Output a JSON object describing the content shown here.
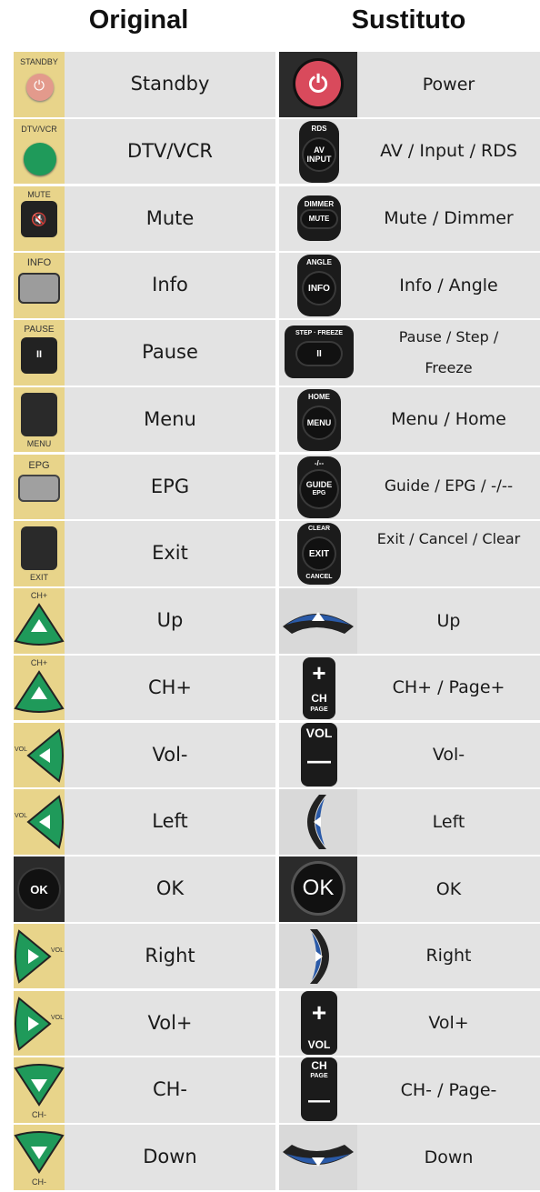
{
  "headers": {
    "original": "Original",
    "substitute": "Sustituto"
  },
  "rows": [
    {
      "original": "Standby",
      "substitute": "Power",
      "orig_icon": {
        "caption": "STANDBY",
        "symbol": "⏻"
      },
      "sub_icon": {
        "symbol": "⏻"
      }
    },
    {
      "original": "DTV/VCR",
      "substitute": "AV / Input / RDS",
      "orig_icon": {
        "caption": "DTV/VCR"
      },
      "sub_icon": {
        "top": "RDS",
        "line1": "AV",
        "line2": "INPUT"
      }
    },
    {
      "original": "Mute",
      "substitute": "Mute / Dimmer",
      "orig_icon": {
        "caption": "MUTE",
        "symbol": "🔇"
      },
      "sub_icon": {
        "top": "DIMMER",
        "line1": "MUTE"
      }
    },
    {
      "original": "Info",
      "substitute": "Info / Angle",
      "orig_icon": {
        "caption": "INFO"
      },
      "sub_icon": {
        "top": "ANGLE",
        "line1": "INFO"
      }
    },
    {
      "original": "Pause",
      "substitute": "Pause / Step / Freeze",
      "orig_icon": {
        "caption": "PAUSE",
        "symbol": "II"
      },
      "sub_icon": {
        "top": "STEP · FREEZE",
        "line1": "II"
      }
    },
    {
      "original": "Menu",
      "substitute": "Menu / Home",
      "orig_icon": {
        "caption": "MENU"
      },
      "sub_icon": {
        "top": "HOME",
        "line1": "MENU"
      }
    },
    {
      "original": "EPG",
      "substitute": "Guide / EPG / -/--",
      "orig_icon": {
        "caption": "EPG"
      },
      "sub_icon": {
        "top": "-/--",
        "line1": "GUIDE",
        "line2": "EPG"
      }
    },
    {
      "original": "Exit",
      "substitute": "Exit / Cancel / Clear",
      "orig_icon": {
        "caption": "EXIT"
      },
      "sub_icon": {
        "top": "CLEAR",
        "line1": "EXIT",
        "bottom": "CANCEL"
      }
    },
    {
      "original": "Up",
      "substitute": "Up",
      "orig_icon": {
        "caption": "CH+"
      },
      "sub_icon": {}
    },
    {
      "original": "CH+",
      "substitute": "CH+ / Page+",
      "orig_icon": {
        "caption": "CH+"
      },
      "sub_icon": {
        "line1": "+",
        "line2": "CH",
        "bottom": "PAGE"
      }
    },
    {
      "original": "Vol-",
      "substitute": "Vol-",
      "orig_icon": {
        "caption": "VOL"
      },
      "sub_icon": {
        "top": "VOL",
        "line1": "—"
      }
    },
    {
      "original": "Left",
      "substitute": "Left",
      "orig_icon": {
        "caption": "VOL"
      },
      "sub_icon": {}
    },
    {
      "original": "OK",
      "substitute": "OK",
      "orig_icon": {
        "symbol": "OK"
      },
      "sub_icon": {
        "symbol": "OK"
      }
    },
    {
      "original": "Right",
      "substitute": "Right",
      "orig_icon": {
        "caption": "VOL"
      },
      "sub_icon": {}
    },
    {
      "original": "Vol+",
      "substitute": "Vol+",
      "orig_icon": {
        "caption": "VOL"
      },
      "sub_icon": {
        "line1": "+",
        "bottom": "VOL"
      }
    },
    {
      "original": "CH-",
      "substitute": "CH- / Page-",
      "orig_icon": {
        "caption": "CH-"
      },
      "sub_icon": {
        "top": "CH",
        "line1": "PAGE",
        "line2": "—"
      }
    },
    {
      "original": "Down",
      "substitute": "Down",
      "orig_icon": {
        "caption": "CH-"
      },
      "sub_icon": {}
    }
  ],
  "colors": {
    "row_bg": "#e3e3e3",
    "remote_yellow": "#e8d48a",
    "green": "#1f9a5a",
    "blue": "#2a5aa8",
    "power_red": "#d94a5c"
  }
}
